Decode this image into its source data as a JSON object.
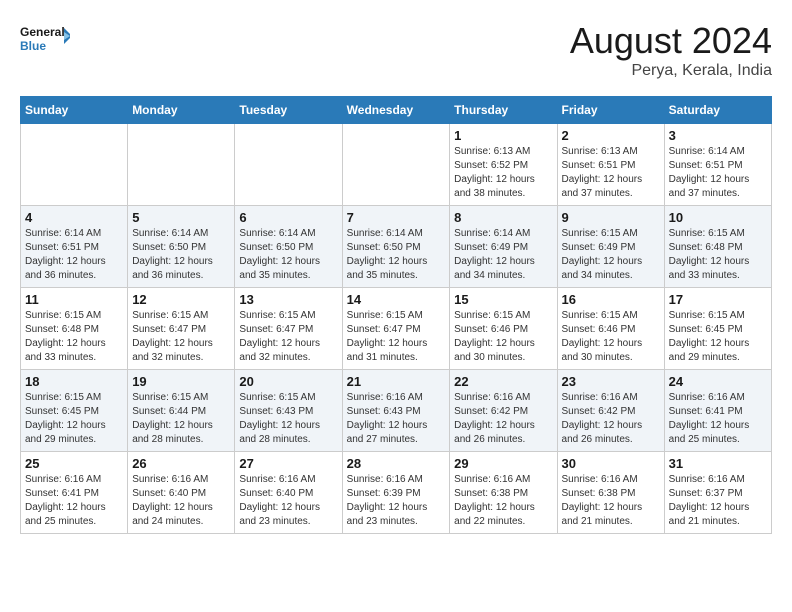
{
  "logo": {
    "line1": "General",
    "line2": "Blue"
  },
  "title": "August 2024",
  "location": "Perya, Kerala, India",
  "days_of_week": [
    "Sunday",
    "Monday",
    "Tuesday",
    "Wednesday",
    "Thursday",
    "Friday",
    "Saturday"
  ],
  "weeks": [
    [
      {
        "day": "",
        "info": ""
      },
      {
        "day": "",
        "info": ""
      },
      {
        "day": "",
        "info": ""
      },
      {
        "day": "",
        "info": ""
      },
      {
        "day": "1",
        "info": "Sunrise: 6:13 AM\nSunset: 6:52 PM\nDaylight: 12 hours and 38 minutes."
      },
      {
        "day": "2",
        "info": "Sunrise: 6:13 AM\nSunset: 6:51 PM\nDaylight: 12 hours and 37 minutes."
      },
      {
        "day": "3",
        "info": "Sunrise: 6:14 AM\nSunset: 6:51 PM\nDaylight: 12 hours and 37 minutes."
      }
    ],
    [
      {
        "day": "4",
        "info": "Sunrise: 6:14 AM\nSunset: 6:51 PM\nDaylight: 12 hours and 36 minutes."
      },
      {
        "day": "5",
        "info": "Sunrise: 6:14 AM\nSunset: 6:50 PM\nDaylight: 12 hours and 36 minutes."
      },
      {
        "day": "6",
        "info": "Sunrise: 6:14 AM\nSunset: 6:50 PM\nDaylight: 12 hours and 35 minutes."
      },
      {
        "day": "7",
        "info": "Sunrise: 6:14 AM\nSunset: 6:50 PM\nDaylight: 12 hours and 35 minutes."
      },
      {
        "day": "8",
        "info": "Sunrise: 6:14 AM\nSunset: 6:49 PM\nDaylight: 12 hours and 34 minutes."
      },
      {
        "day": "9",
        "info": "Sunrise: 6:15 AM\nSunset: 6:49 PM\nDaylight: 12 hours and 34 minutes."
      },
      {
        "day": "10",
        "info": "Sunrise: 6:15 AM\nSunset: 6:48 PM\nDaylight: 12 hours and 33 minutes."
      }
    ],
    [
      {
        "day": "11",
        "info": "Sunrise: 6:15 AM\nSunset: 6:48 PM\nDaylight: 12 hours and 33 minutes."
      },
      {
        "day": "12",
        "info": "Sunrise: 6:15 AM\nSunset: 6:47 PM\nDaylight: 12 hours and 32 minutes."
      },
      {
        "day": "13",
        "info": "Sunrise: 6:15 AM\nSunset: 6:47 PM\nDaylight: 12 hours and 32 minutes."
      },
      {
        "day": "14",
        "info": "Sunrise: 6:15 AM\nSunset: 6:47 PM\nDaylight: 12 hours and 31 minutes."
      },
      {
        "day": "15",
        "info": "Sunrise: 6:15 AM\nSunset: 6:46 PM\nDaylight: 12 hours and 30 minutes."
      },
      {
        "day": "16",
        "info": "Sunrise: 6:15 AM\nSunset: 6:46 PM\nDaylight: 12 hours and 30 minutes."
      },
      {
        "day": "17",
        "info": "Sunrise: 6:15 AM\nSunset: 6:45 PM\nDaylight: 12 hours and 29 minutes."
      }
    ],
    [
      {
        "day": "18",
        "info": "Sunrise: 6:15 AM\nSunset: 6:45 PM\nDaylight: 12 hours and 29 minutes."
      },
      {
        "day": "19",
        "info": "Sunrise: 6:15 AM\nSunset: 6:44 PM\nDaylight: 12 hours and 28 minutes."
      },
      {
        "day": "20",
        "info": "Sunrise: 6:15 AM\nSunset: 6:43 PM\nDaylight: 12 hours and 28 minutes."
      },
      {
        "day": "21",
        "info": "Sunrise: 6:16 AM\nSunset: 6:43 PM\nDaylight: 12 hours and 27 minutes."
      },
      {
        "day": "22",
        "info": "Sunrise: 6:16 AM\nSunset: 6:42 PM\nDaylight: 12 hours and 26 minutes."
      },
      {
        "day": "23",
        "info": "Sunrise: 6:16 AM\nSunset: 6:42 PM\nDaylight: 12 hours and 26 minutes."
      },
      {
        "day": "24",
        "info": "Sunrise: 6:16 AM\nSunset: 6:41 PM\nDaylight: 12 hours and 25 minutes."
      }
    ],
    [
      {
        "day": "25",
        "info": "Sunrise: 6:16 AM\nSunset: 6:41 PM\nDaylight: 12 hours and 25 minutes."
      },
      {
        "day": "26",
        "info": "Sunrise: 6:16 AM\nSunset: 6:40 PM\nDaylight: 12 hours and 24 minutes."
      },
      {
        "day": "27",
        "info": "Sunrise: 6:16 AM\nSunset: 6:40 PM\nDaylight: 12 hours and 23 minutes."
      },
      {
        "day": "28",
        "info": "Sunrise: 6:16 AM\nSunset: 6:39 PM\nDaylight: 12 hours and 23 minutes."
      },
      {
        "day": "29",
        "info": "Sunrise: 6:16 AM\nSunset: 6:38 PM\nDaylight: 12 hours and 22 minutes."
      },
      {
        "day": "30",
        "info": "Sunrise: 6:16 AM\nSunset: 6:38 PM\nDaylight: 12 hours and 21 minutes."
      },
      {
        "day": "31",
        "info": "Sunrise: 6:16 AM\nSunset: 6:37 PM\nDaylight: 12 hours and 21 minutes."
      }
    ]
  ]
}
